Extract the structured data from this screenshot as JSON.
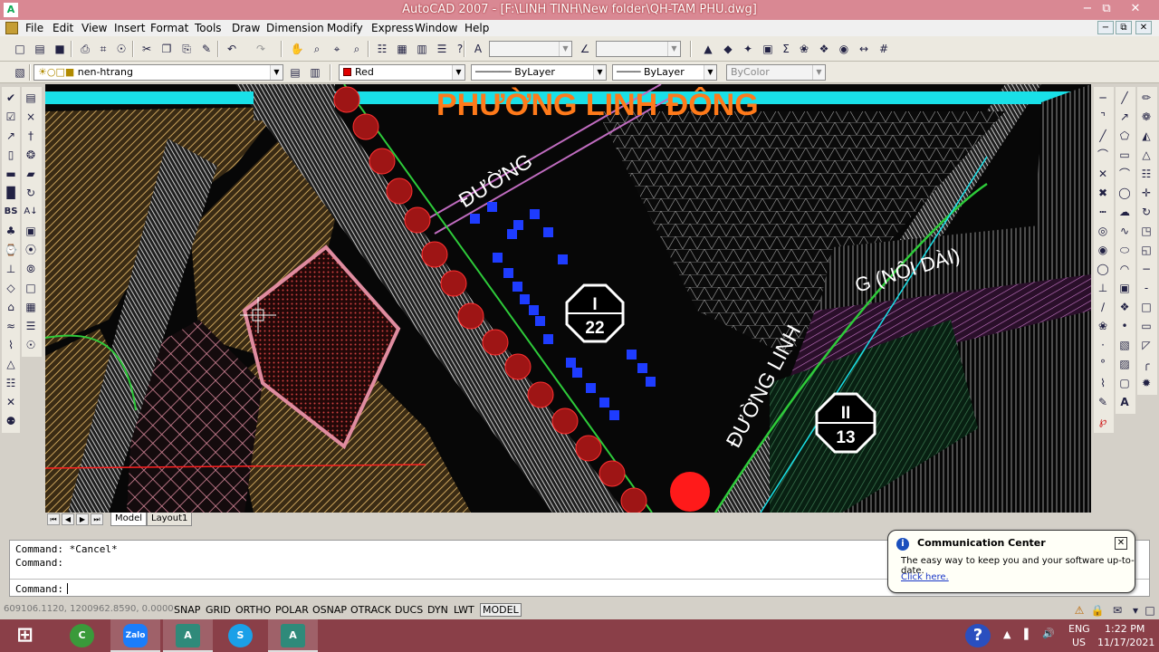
{
  "window": {
    "title": "AutoCAD 2007 - [F:\\LINH TINH\\New folder\\QH-TAM PHU.dwg]"
  },
  "menu": [
    "File",
    "Edit",
    "View",
    "Insert",
    "Format",
    "Tools",
    "Draw",
    "Dimension",
    "Modify",
    "Express",
    "Window",
    "Help"
  ],
  "layers": {
    "current": "nen-htrang"
  },
  "properties": {
    "color": "Red",
    "linetype": "ByLayer",
    "lineweight": "ByLayer",
    "plotstyle": "ByColor"
  },
  "drawing": {
    "ward_label": "PHƯỜNG LINH ĐÔNG",
    "street_1": "ĐƯỜNG",
    "street_2": "ĐƯỜNG LINH",
    "street_3": "G (NỘI DÀI)",
    "lot_1_top": "I",
    "lot_1_bottom": "22",
    "lot_2_top": "II",
    "lot_2_bottom": "13",
    "colors": {
      "hatch_brown": "#9a7d4a",
      "hatch_pink": "#e08ca0",
      "road_white": "#f2f2f2",
      "dot_red": "#c01a1a",
      "blue_mark": "#1e3cff",
      "orange_text": "#ff7a1a",
      "cyan_band": "#19e0e8",
      "green_line": "#2ecb3a"
    }
  },
  "tabs": [
    "Model",
    "Layout1"
  ],
  "command": {
    "history": [
      "Command: *Cancel*",
      "Command:"
    ],
    "prompt": "Command:"
  },
  "status": {
    "coords": "609106.1120, 1200962.8590, 0.0000",
    "toggles": [
      "SNAP",
      "GRID",
      "ORTHO",
      "POLAR",
      "OSNAP",
      "OTRACK",
      "DUCS",
      "DYN",
      "LWT"
    ],
    "mode": "MODEL"
  },
  "notification": {
    "title": "Communication Center",
    "message": "The easy way to keep you and your software up-to-date.",
    "link": "Click here."
  },
  "taskbar": {
    "apps": [
      "Start",
      "CCleaner",
      "Zalo",
      "AutoCAD",
      "Skype",
      "AutoCAD"
    ],
    "lang_1": "ENG",
    "lang_2": "US",
    "time": "1:22 PM",
    "date": "11/17/2021"
  }
}
